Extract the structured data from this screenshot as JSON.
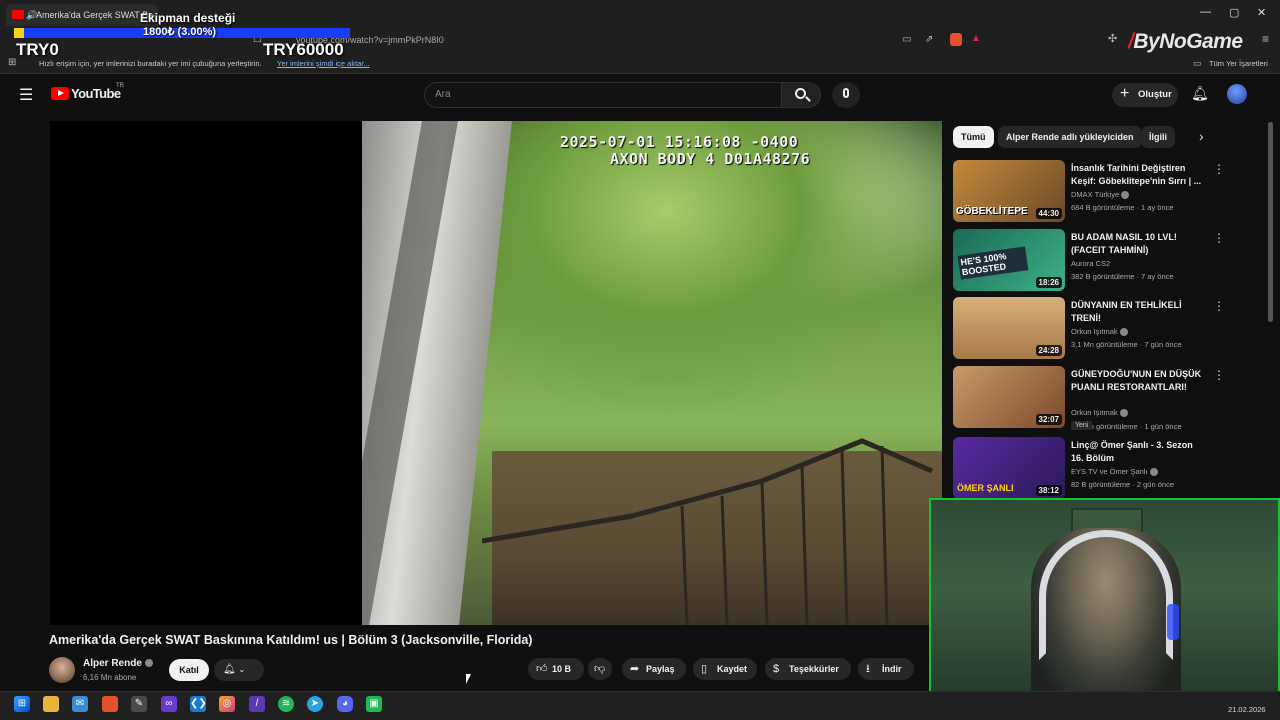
{
  "browser": {
    "tab_title": "Amerika'da Gerçek SWAT Ba",
    "url": "youtube.com/watch?v=jmmPkPrN8I0",
    "bookmarks_hint": "Hızlı erişim için, yer imlerinizi buradaki yer imi çubuğuna yerleştirin.",
    "bookmarks_link": "Yer imlerini şimdi içe aktar...",
    "all_bookmarks": "Tüm Yer İşaretleri"
  },
  "overlay": {
    "donation_title": "Ekipman desteği",
    "donation_amount": "1800₺ (3.00%)",
    "donation_progress": 0.03,
    "donation_min": "TRY0",
    "donation_max": "TRY60000",
    "brand_left": "By",
    "brand_right": "NoGame"
  },
  "youtube": {
    "logo": "YouTube",
    "region": "TR",
    "search_placeholder": "Ara",
    "create_label": "Oluştur"
  },
  "video": {
    "timestamp_line1": "2025-07-01 15:16:08 -0400",
    "timestamp_line2": "AXON BODY 4 D01A48276",
    "title": "Amerika'da Gerçek SWAT Baskınına Katıldım! us | Bölüm 3 (Jacksonville, Florida)",
    "channel": "Alper Rende",
    "subscribers": "6,16 Mn abone",
    "join_label": "Katıl",
    "likes": "10 B",
    "share_label": "Paylaş",
    "save_label": "Kaydet",
    "thanks_label": "Teşekkürler",
    "download_label": "İndir"
  },
  "sidebar": {
    "chips": [
      "Tümü",
      "Alper Rende adlı yükleyiciden",
      "İlgili"
    ],
    "recommendations": [
      {
        "title": "İnsanlık Tarihini Değiştiren Keşif: Göbeklitepe'nin Sırrı | ...",
        "channel": "DMAX Türkiye",
        "meta": "684 B görüntüleme · 1 ay önce",
        "duration": "44:30",
        "thumb_text": "GÖBEKLİTEPE",
        "thumb_color": "#8a6a3a"
      },
      {
        "title": "BU ADAM NASIL 10 LVL! (FACEIT TAHMİNİ)",
        "channel": "Aurora CS2",
        "meta": "382 B görüntüleme · 7 ay önce",
        "duration": "18:26",
        "thumb_text": "HE'S 100% BOOSTED",
        "thumb_color": "#1e8a6a"
      },
      {
        "title": "DÜNYANIN EN TEHLİKELİ TRENİ!",
        "channel": "Orkun Işıtmak",
        "meta": "3,1 Mn görüntüleme · 7 gün önce",
        "duration": "24:28",
        "thumb_text": "",
        "thumb_color": "#b88a55"
      },
      {
        "title": "GÜNEYDOĞU'NUN EN DÜŞÜK PUANLI RESTORANTLARI!",
        "channel": "Orkun Işıtmak",
        "meta": "1,6 Mn görüntüleme · 1 gün önce",
        "duration": "32:07",
        "thumb_text": "",
        "thumb_color": "#9a6a45",
        "badge": "Yeni"
      },
      {
        "title": "Linç@ Ömer Şanlı - 3. Sezon 16. Bölüm",
        "channel": "EYS TV ve Ömer Şanlı",
        "meta": "82 B görüntüleme · 2 gün önce",
        "duration": "38:12",
        "thumb_text": "ÖMER ŞANLI",
        "thumb_color": "#4a2a8a"
      }
    ]
  },
  "taskbar": {
    "date": "21.02.2026"
  },
  "colors": {
    "accent_red": "#ff0000",
    "donation_blue": "#1a3cff",
    "donation_fill": "#f2d41a",
    "webcam_border": "#12c52c"
  }
}
